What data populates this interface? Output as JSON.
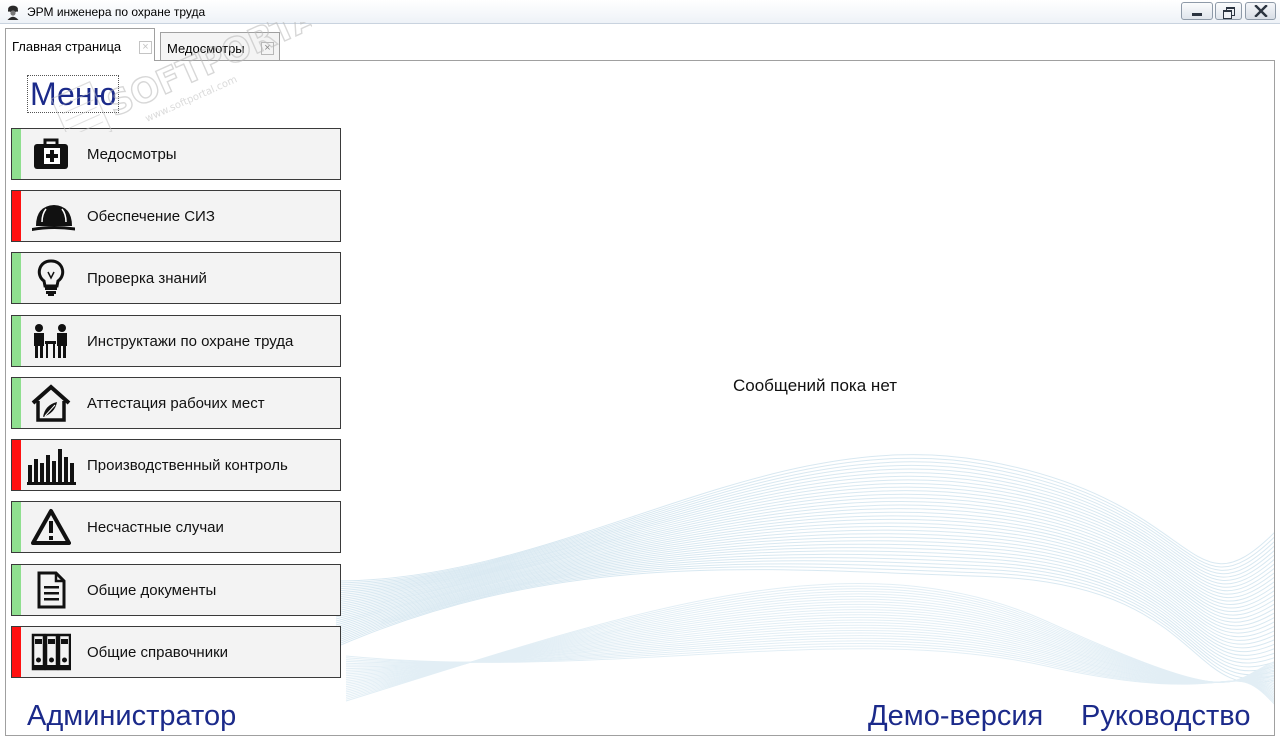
{
  "window": {
    "title": "ЭРМ инженера по охране труда"
  },
  "tabs": [
    {
      "label": "Главная страница",
      "close": "×"
    },
    {
      "label": "Медосмотры",
      "close": "×"
    }
  ],
  "menu": {
    "title": "Меню",
    "items": [
      {
        "label": "Медосмотры",
        "status_color": "#8fdf8f",
        "icon": "medical-kit-icon"
      },
      {
        "label": "Обеспечение СИЗ",
        "status_color": "#ff1010",
        "icon": "hard-hat-icon"
      },
      {
        "label": "Проверка знаний",
        "status_color": "#8fdf8f",
        "icon": "light-bulb-icon"
      },
      {
        "label": "Инструктажи по охране труда",
        "status_color": "#8fdf8f",
        "icon": "briefing-people-icon"
      },
      {
        "label": "Аттестация рабочих мест",
        "status_color": "#8fdf8f",
        "icon": "house-icon"
      },
      {
        "label": "Производственный контроль",
        "status_color": "#ff1010",
        "icon": "factory-icon"
      },
      {
        "label": "Несчастные случаи",
        "status_color": "#8fdf8f",
        "icon": "warning-icon"
      },
      {
        "label": "Общие документы",
        "status_color": "#8fdf8f",
        "icon": "document-icon"
      },
      {
        "label": "Общие справочники",
        "status_color": "#ff1010",
        "icon": "binders-icon"
      }
    ]
  },
  "main": {
    "status_message": "Сообщений пока нет"
  },
  "footer": {
    "user": "Администратор",
    "demo": "Демо-версия",
    "guide": "Руководство"
  },
  "watermark": {
    "brand": "SOFTPORTAL",
    "url": "www.softportal.com"
  }
}
